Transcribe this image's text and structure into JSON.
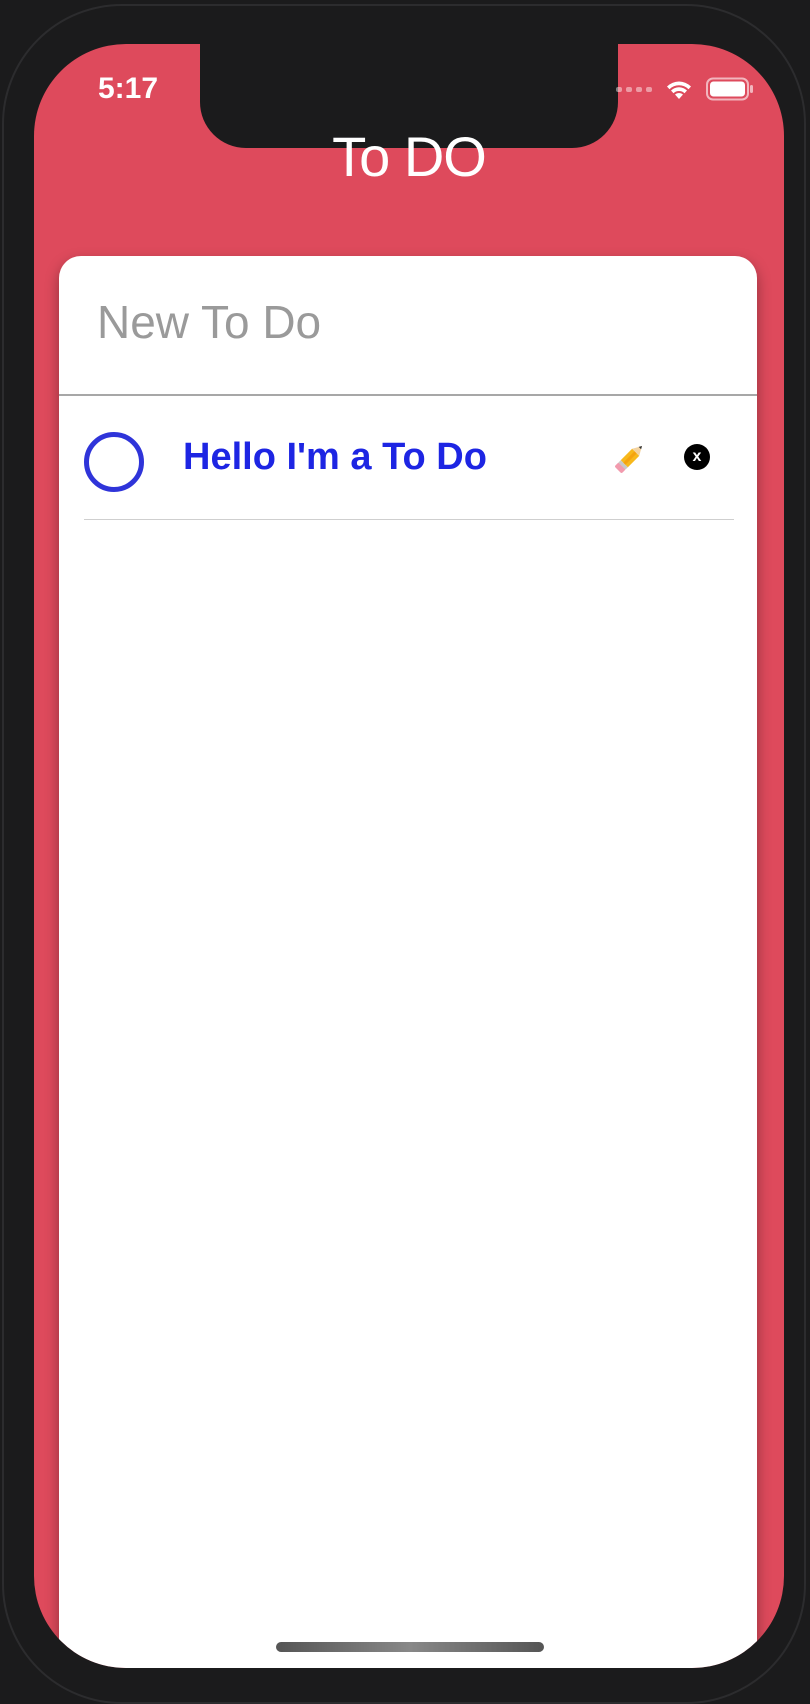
{
  "status_bar": {
    "time": "5:17",
    "icons": [
      "cellular-signal-icon",
      "wifi-icon",
      "battery-icon"
    ]
  },
  "app": {
    "title": "To DO"
  },
  "new_todo": {
    "placeholder": "New To Do",
    "value": ""
  },
  "todos": [
    {
      "text": "Hello I'm a To Do",
      "completed": false,
      "edit_icon": "pencil-icon",
      "delete_label": "x"
    }
  ],
  "colors": {
    "background": "#de4a5c",
    "todo_text": "#1d25e3",
    "checkbox": "#2f34d9",
    "card": "#ffffff"
  }
}
